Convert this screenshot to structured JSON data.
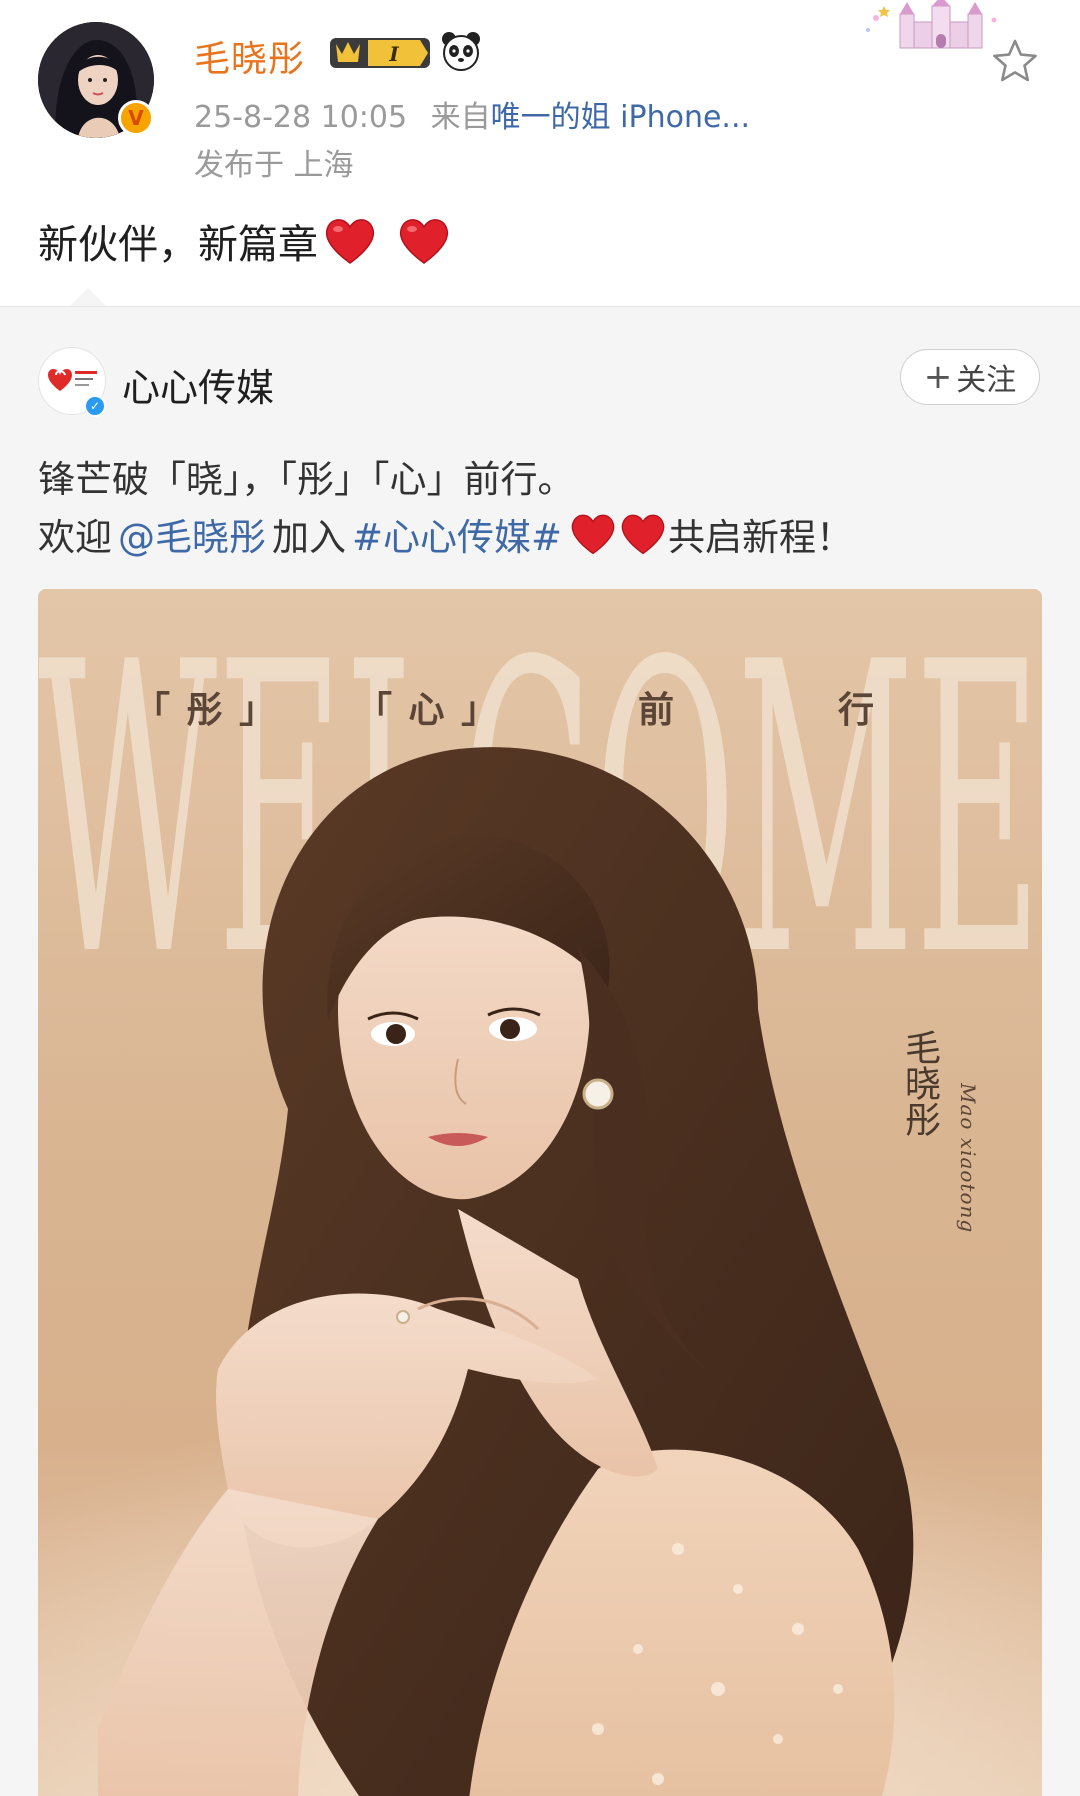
{
  "post": {
    "username": "毛晓彤",
    "vip_level": "I",
    "timestamp": "25-8-28 10:05",
    "source_prefix": "来自",
    "source_device": "唯一的姐 iPhone...",
    "location": "发布于 上海",
    "text": "新伙伴，新篇章"
  },
  "repost": {
    "account_name": "心心传媒",
    "follow_label": "关注",
    "follow_plus": "+",
    "line1": "锋芒破「晓」，「彤」「心」前行。",
    "line2_prefix": "欢迎",
    "mention": "@毛晓彤",
    "line2_middle": "加入",
    "topic": "#心心传媒#",
    "line2_suffix": "共启新程！"
  },
  "poster": {
    "watermark": "WELCOME",
    "caption_1": "「 彤 」",
    "caption_2": "「 心 」",
    "caption_3": "前",
    "caption_4": "行",
    "name_cn": "毛晓彤",
    "name_latin": "Mao xiaotong"
  },
  "colors": {
    "username": "#e8741f",
    "link": "#3f69a6",
    "meta": "#9a9a9a",
    "repost_bg": "#f5f5f6",
    "heart": "#e0202a"
  },
  "icons": {
    "star": "star-outline-icon",
    "heart": "red-heart-icon",
    "panda": "panda-icon",
    "castle": "castle-icon"
  }
}
